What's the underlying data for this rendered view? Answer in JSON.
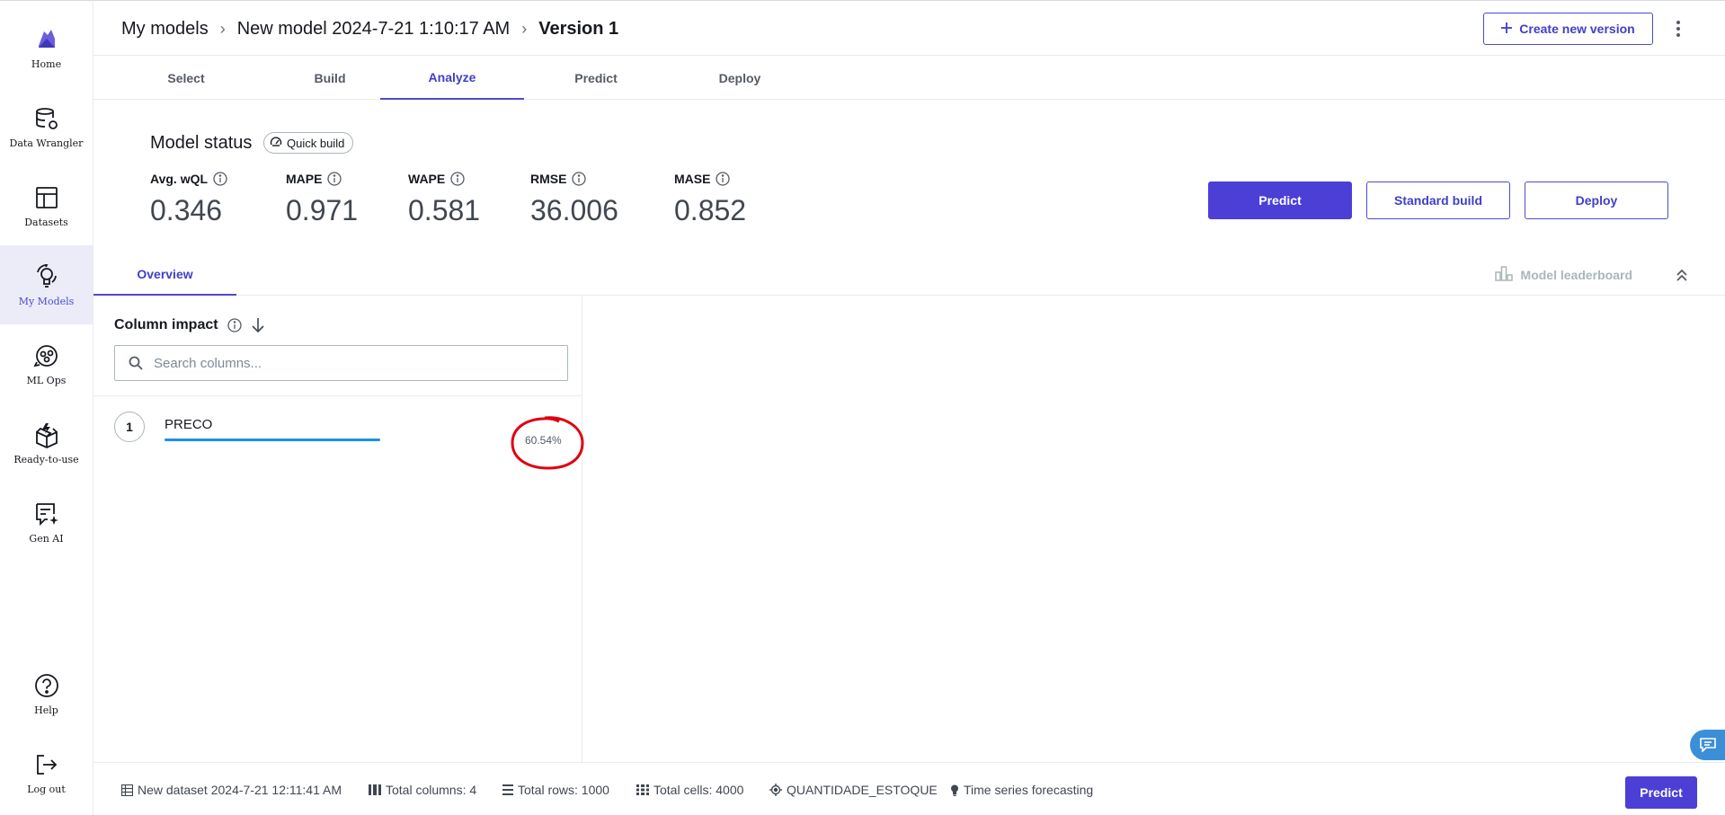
{
  "sidebar": {
    "items": [
      {
        "label": "Home",
        "icon": "canvas-logo-icon"
      },
      {
        "label": "Data Wrangler",
        "icon": "database-icon"
      },
      {
        "label": "Datasets",
        "icon": "table-icon"
      },
      {
        "label": "My Models",
        "icon": "bulb-icon",
        "active": true
      },
      {
        "label": "ML Ops",
        "icon": "mlops-icon"
      },
      {
        "label": "Ready-to-use",
        "icon": "box-icon"
      },
      {
        "label": "Gen AI",
        "icon": "chat-sparkle-icon"
      },
      {
        "label": "Help",
        "icon": "help-icon"
      },
      {
        "label": "Log out",
        "icon": "logout-icon"
      }
    ]
  },
  "header": {
    "breadcrumb": [
      "My models",
      "New model 2024-7-21 1:10:17 AM",
      "Version 1"
    ],
    "create_version_label": "Create new version"
  },
  "steps": {
    "tabs": [
      "Select",
      "Build",
      "Analyze",
      "Predict",
      "Deploy"
    ],
    "active": "Analyze"
  },
  "status": {
    "title": "Model status",
    "build_type": "Quick build",
    "metrics": [
      {
        "name": "Avg. wQL",
        "value": "0.346"
      },
      {
        "name": "MAPE",
        "value": "0.971"
      },
      {
        "name": "WAPE",
        "value": "0.581"
      },
      {
        "name": "RMSE",
        "value": "36.006"
      },
      {
        "name": "MASE",
        "value": "0.852"
      }
    ],
    "actions": {
      "predict": "Predict",
      "standard_build": "Standard build",
      "deploy": "Deploy"
    }
  },
  "overview": {
    "tab_label": "Overview",
    "leaderboard_label": "Model leaderboard"
  },
  "column_impact": {
    "title": "Column impact",
    "search_placeholder": "Search columns...",
    "rows": [
      {
        "rank": "1",
        "name": "PRECO",
        "impact": "60.54%",
        "impact_fraction": 0.6054
      }
    ]
  },
  "footer": {
    "dataset": "New dataset 2024-7-21 12:11:41 AM",
    "total_columns": "Total columns: 4",
    "total_rows": "Total rows: 1000",
    "total_cells": "Total cells: 4000",
    "target": "QUANTIDADE_ESTOQUE",
    "problem_type": "Time series forecasting",
    "predict_label": "Predict"
  },
  "colors": {
    "accent": "#4b3fd6",
    "bar": "#1e8ef0",
    "annotation": "#e0000f"
  }
}
